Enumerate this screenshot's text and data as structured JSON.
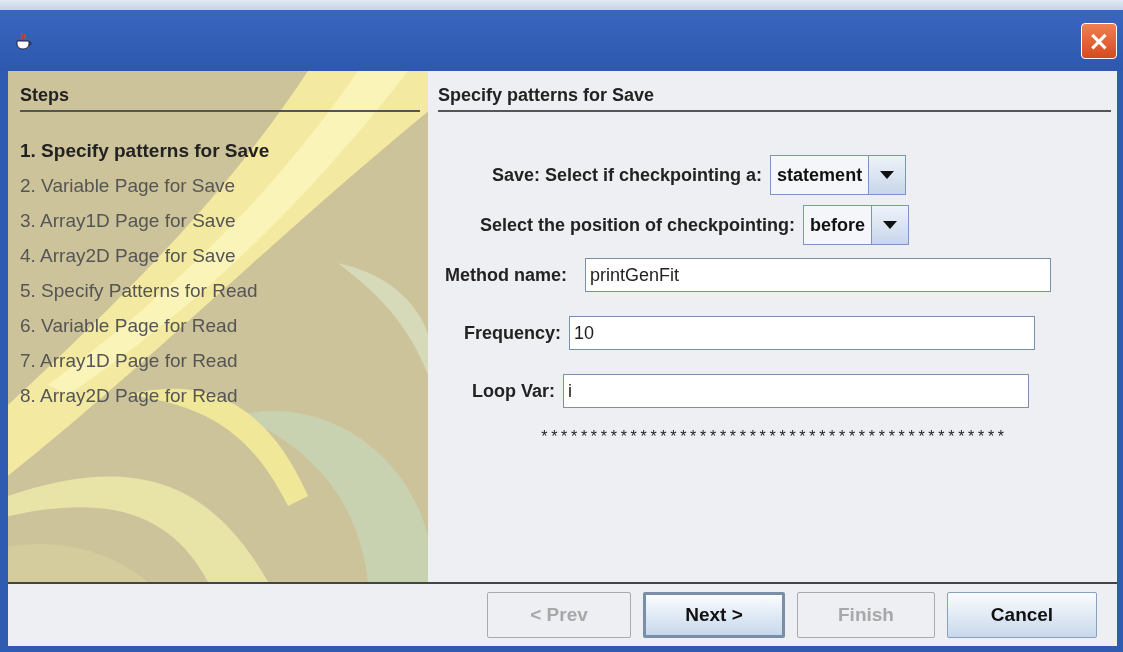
{
  "window": {
    "close_label": "×"
  },
  "steps": {
    "title": "Steps",
    "items": [
      {
        "label": "1. Specify patterns for Save",
        "selected": true
      },
      {
        "label": "2. Variable Page for Save",
        "selected": false
      },
      {
        "label": "3. Array1D Page for Save",
        "selected": false
      },
      {
        "label": "4. Array2D Page for Save",
        "selected": false
      },
      {
        "label": "5. Specify Patterns for Read",
        "selected": false
      },
      {
        "label": "6. Variable Page for Read",
        "selected": false
      },
      {
        "label": "7. Array1D Page for Read",
        "selected": false
      },
      {
        "label": "8. Array2D Page for Read",
        "selected": false
      }
    ]
  },
  "page": {
    "title": "Specify patterns for Save",
    "rows": [
      {
        "kind": "dropdown",
        "label": "Save: Select if checkpointing a:",
        "value": "statement"
      },
      {
        "kind": "dropdown",
        "label": "Select the position of checkpointing:",
        "value": "before"
      },
      {
        "kind": "field",
        "label": "Method name:",
        "value": "printGenFit"
      },
      {
        "kind": "field",
        "label": "Frequency:",
        "value": "10"
      },
      {
        "kind": "field",
        "label": "Loop Var:",
        "value": "i"
      }
    ],
    "separator": "***********************************************"
  },
  "buttons": [
    {
      "label": "< Prev",
      "disabled": true,
      "default": false
    },
    {
      "label": "Next >",
      "disabled": false,
      "default": true
    },
    {
      "label": "Finish",
      "disabled": true,
      "default": false
    },
    {
      "label": "Cancel",
      "disabled": false,
      "default": false
    }
  ]
}
